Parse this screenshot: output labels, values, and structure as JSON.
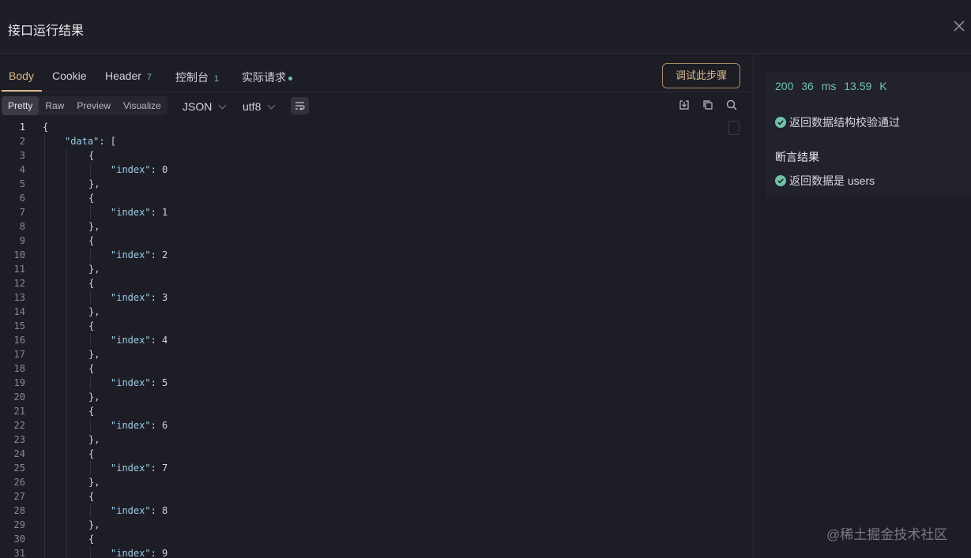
{
  "window": {
    "title": "接口运行结果"
  },
  "tabs": [
    {
      "label": "Body"
    },
    {
      "label": "Cookie"
    },
    {
      "label": "Header",
      "count": "7"
    },
    {
      "label": "控制台",
      "count": "1"
    },
    {
      "label": "实际请求"
    }
  ],
  "debug_button": "调试此步骤",
  "view_modes": [
    "Pretty",
    "Raw",
    "Preview",
    "Visualize"
  ],
  "format_select": "JSON",
  "encoding_select": "utf8",
  "editor": {
    "lines": [
      {
        "n": "1",
        "text": "{"
      },
      {
        "n": "2",
        "key": "\"data\"",
        "text": ": ["
      },
      {
        "n": "3",
        "text": "{"
      },
      {
        "n": "4",
        "key": "\"index\"",
        "text": ": 0"
      },
      {
        "n": "5",
        "text": "},"
      },
      {
        "n": "6",
        "text": "{"
      },
      {
        "n": "7",
        "key": "\"index\"",
        "text": ": 1"
      },
      {
        "n": "8",
        "text": "},"
      },
      {
        "n": "9",
        "text": "{"
      },
      {
        "n": "10",
        "key": "\"index\"",
        "text": ": 2"
      },
      {
        "n": "11",
        "text": "},"
      },
      {
        "n": "12",
        "text": "{"
      },
      {
        "n": "13",
        "key": "\"index\"",
        "text": ": 3"
      },
      {
        "n": "14",
        "text": "},"
      },
      {
        "n": "15",
        "text": "{"
      },
      {
        "n": "16",
        "key": "\"index\"",
        "text": ": 4"
      },
      {
        "n": "17",
        "text": "},"
      },
      {
        "n": "18",
        "text": "{"
      },
      {
        "n": "19",
        "key": "\"index\"",
        "text": ": 5"
      },
      {
        "n": "20",
        "text": "},"
      },
      {
        "n": "21",
        "text": "{"
      },
      {
        "n": "22",
        "key": "\"index\"",
        "text": ": 6"
      },
      {
        "n": "23",
        "text": "},"
      },
      {
        "n": "24",
        "text": "{"
      },
      {
        "n": "25",
        "key": "\"index\"",
        "text": ": 7"
      },
      {
        "n": "26",
        "text": "},"
      },
      {
        "n": "27",
        "text": "{"
      },
      {
        "n": "28",
        "key": "\"index\"",
        "text": ": 8"
      },
      {
        "n": "29",
        "text": "},"
      },
      {
        "n": "30",
        "text": "{"
      },
      {
        "n": "31",
        "key": "\"index\"",
        "text": ": 9"
      }
    ]
  },
  "response": {
    "status": "200",
    "time": "36 ms",
    "size": "13.59 K",
    "schema_check": "返回数据结构校验通过",
    "assert_title": "断言结果",
    "assertion": "返回数据是 users"
  },
  "watermark": "@稀土掘金技术社区",
  "colors": {
    "accent": "#d9b98a",
    "success": "#6fc2a8",
    "background": "#1d1d26"
  }
}
